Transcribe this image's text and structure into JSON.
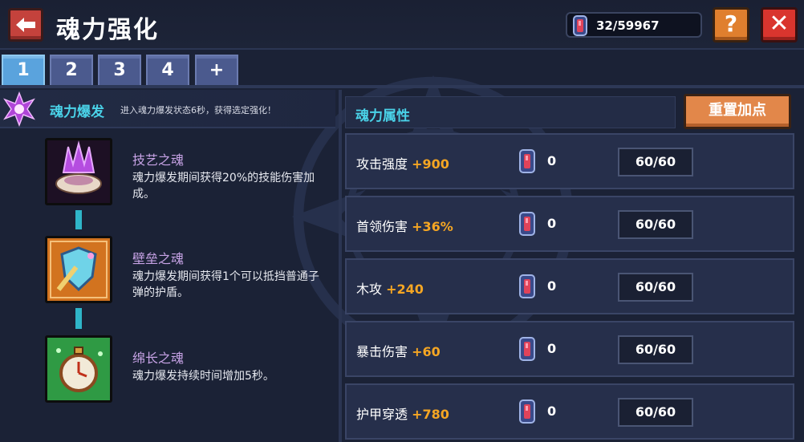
{
  "header": {
    "title": "魂力强化",
    "currency_value": "32/59967",
    "help_label": "?",
    "close_label": "✕"
  },
  "tabs": [
    {
      "label": "1",
      "active": true
    },
    {
      "label": "2",
      "active": false
    },
    {
      "label": "3",
      "active": false
    },
    {
      "label": "4",
      "active": false
    },
    {
      "label": "+",
      "active": false
    }
  ],
  "burst": {
    "title": "魂力爆发",
    "description": "进入魂力爆发状态6秒，获得选定强化！"
  },
  "skills": [
    {
      "name": "技艺之魂",
      "description": "魂力爆发期间获得20%的技能伤害加成。",
      "icon": "purple-crystal-shell-icon"
    },
    {
      "name": "壁垒之魂",
      "description": "魂力爆发期间获得1个可以抵挡普通子弹的护盾。",
      "icon": "shield-sword-icon"
    },
    {
      "name": "绵长之魂",
      "description": "魂力爆发持续时间增加5秒。",
      "icon": "pocket-watch-icon"
    }
  ],
  "attributes": {
    "header_label": "魂力属性",
    "reset_label": "重置加点",
    "rows": [
      {
        "name": "攻击强度",
        "bonus": "+900",
        "count": "0",
        "level": "60/60"
      },
      {
        "name": "首领伤害",
        "bonus": "+36%",
        "count": "0",
        "level": "60/60"
      },
      {
        "name": "木攻",
        "bonus": "+240",
        "count": "0",
        "level": "60/60"
      },
      {
        "name": "暴击伤害",
        "bonus": "+60",
        "count": "0",
        "level": "60/60"
      },
      {
        "name": "护甲穿透",
        "bonus": "+780",
        "count": "0",
        "level": "60/60"
      }
    ]
  },
  "colors": {
    "accent_cyan": "#4ad2e8",
    "bonus_orange": "#f5a623",
    "skill_name_purple": "#c7a3e6",
    "button_orange": "#e2874a",
    "close_red": "#d9352e",
    "tab_active": "#5aa3dd"
  }
}
